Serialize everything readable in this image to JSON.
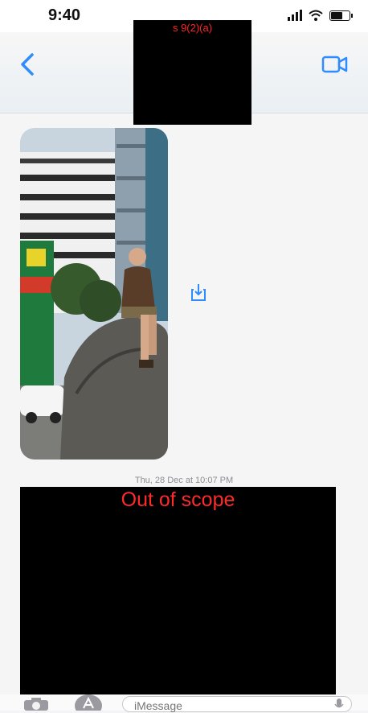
{
  "status_bar": {
    "time": "9:40",
    "icons": [
      "cellular-signal-icon",
      "wifi-icon",
      "battery-icon"
    ]
  },
  "nav": {
    "back_icon": "chevron-left-icon",
    "video_icon": "facetime-video-icon",
    "accent_color": "#2e8cff"
  },
  "redactions": {
    "contact_label": "s 9(2)(a)",
    "content_label": "Out of scope",
    "label_color": "#ff2424"
  },
  "thread": {
    "attachment_action_icon": "save-share-icon",
    "timestamp": "Thu, 28 Dec at 10:07 PM"
  },
  "composer": {
    "camera_icon": "camera-icon",
    "apps_icon": "app-store-icon",
    "placeholder": "iMessage",
    "mic_icon": "microphone-icon"
  }
}
